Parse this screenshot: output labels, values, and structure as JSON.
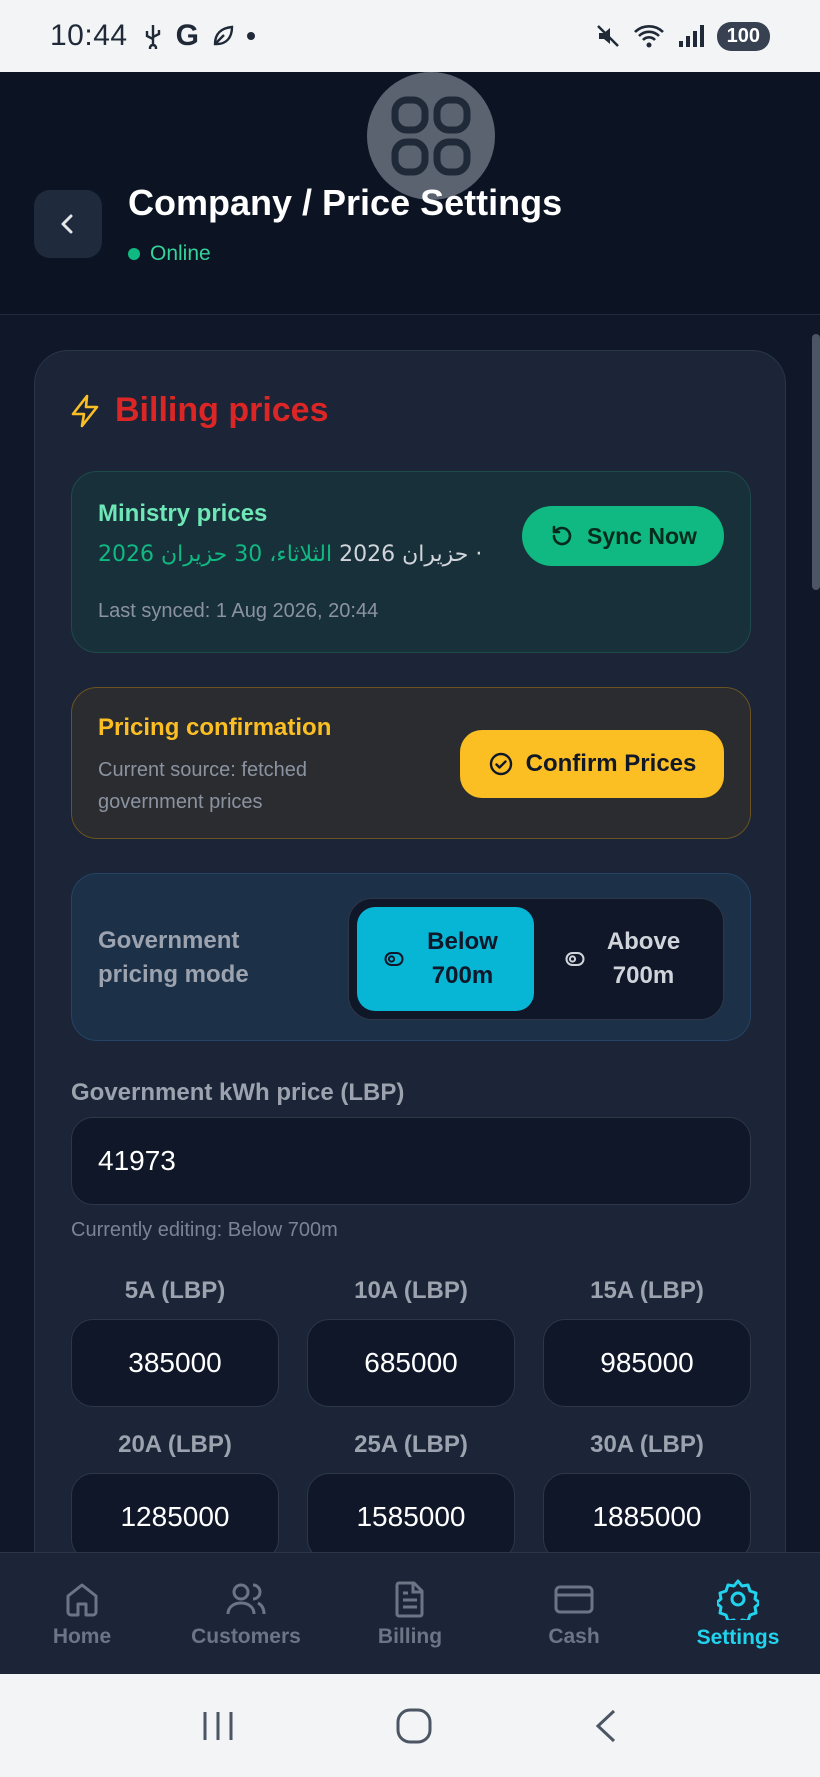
{
  "status_bar": {
    "time": "10:44",
    "battery": "100"
  },
  "header": {
    "title": "Company / Price Settings",
    "status": "Online"
  },
  "card": {
    "title": "Billing prices",
    "ministry": {
      "title": "Ministry prices",
      "date_green": "الثلاثاء، 30 حزيران 2026",
      "date_dim": "· حزيران 2026",
      "last_synced": "Last synced: 1 Aug 2026, 20:44",
      "sync_label": "Sync Now"
    },
    "confirmation": {
      "title": "Pricing confirmation",
      "subtitle": "Current source: fetched government prices",
      "button_label": "Confirm Prices"
    },
    "mode": {
      "label": "Government pricing mode",
      "options": [
        "Below 700m",
        "Above 700m"
      ],
      "selected": "Below 700m"
    },
    "kwh": {
      "label": "Government kWh price (LBP)",
      "value": "41973",
      "note": "Currently editing: Below 700m"
    },
    "amps": [
      {
        "label": "5A (LBP)",
        "value": "385000"
      },
      {
        "label": "10A (LBP)",
        "value": "685000"
      },
      {
        "label": "15A (LBP)",
        "value": "985000"
      },
      {
        "label": "20A (LBP)",
        "value": "1285000"
      },
      {
        "label": "25A (LBP)",
        "value": "1585000"
      },
      {
        "label": "30A (LBP)",
        "value": "1885000"
      }
    ]
  },
  "nav": [
    {
      "label": "Home",
      "icon": "home-icon"
    },
    {
      "label": "Customers",
      "icon": "users-icon"
    },
    {
      "label": "Billing",
      "icon": "document-icon"
    },
    {
      "label": "Cash",
      "icon": "card-icon"
    },
    {
      "label": "Settings",
      "icon": "gear-icon",
      "active": true
    }
  ],
  "colors": {
    "accent": "#06b6d4",
    "title_red": "#dc2626",
    "sync_green": "#10b981",
    "confirm_yellow": "#fbbf24"
  }
}
